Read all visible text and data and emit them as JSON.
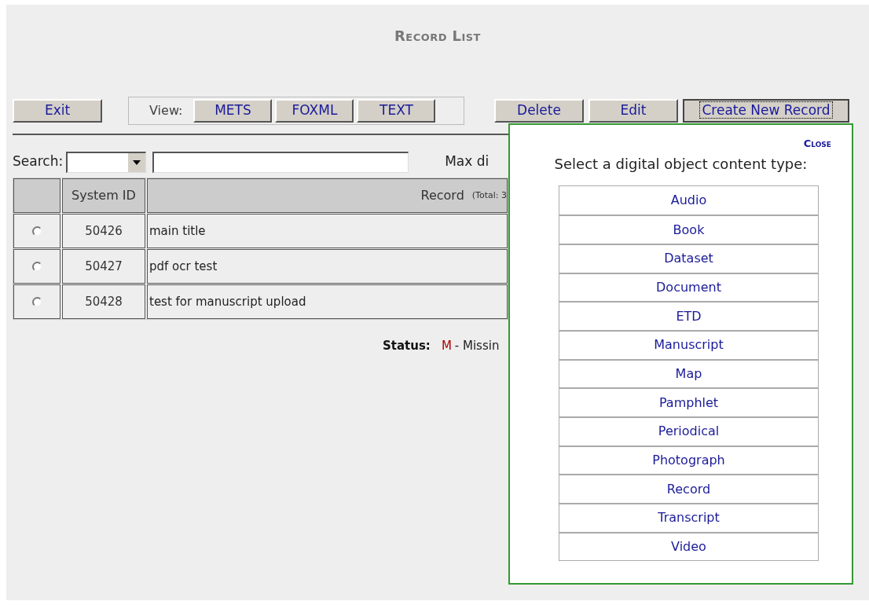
{
  "title": "Record List",
  "toolbar": {
    "exit": "Exit",
    "view_label": "View:",
    "view_buttons": [
      "METS",
      "FOXML",
      "TEXT"
    ],
    "actions": [
      {
        "label": "Delete",
        "focused": false
      },
      {
        "label": "Edit",
        "focused": false
      },
      {
        "label": "Create New Record",
        "focused": true
      }
    ]
  },
  "search": {
    "label": "Search:",
    "max_label": "Max di"
  },
  "table": {
    "columns": [
      "System ID",
      "Record"
    ],
    "total": "(Total: 3",
    "rows": [
      {
        "selected": false,
        "id": "50426",
        "record": "main title"
      },
      {
        "selected": false,
        "id": "50427",
        "record": "pdf ocr test"
      },
      {
        "selected": false,
        "id": "50428",
        "record": "test for manuscript upload"
      }
    ]
  },
  "status": {
    "label": "Status:",
    "code": "M",
    "text": "- Missin"
  },
  "popup": {
    "close": "Close",
    "prompt": "Select a digital object content type:",
    "types": [
      "Audio",
      "Book",
      "Dataset",
      "Document",
      "ETD",
      "Manuscript",
      "Map",
      "Pamphlet",
      "Periodical",
      "Photograph",
      "Record",
      "Transcript",
      "Video"
    ]
  }
}
